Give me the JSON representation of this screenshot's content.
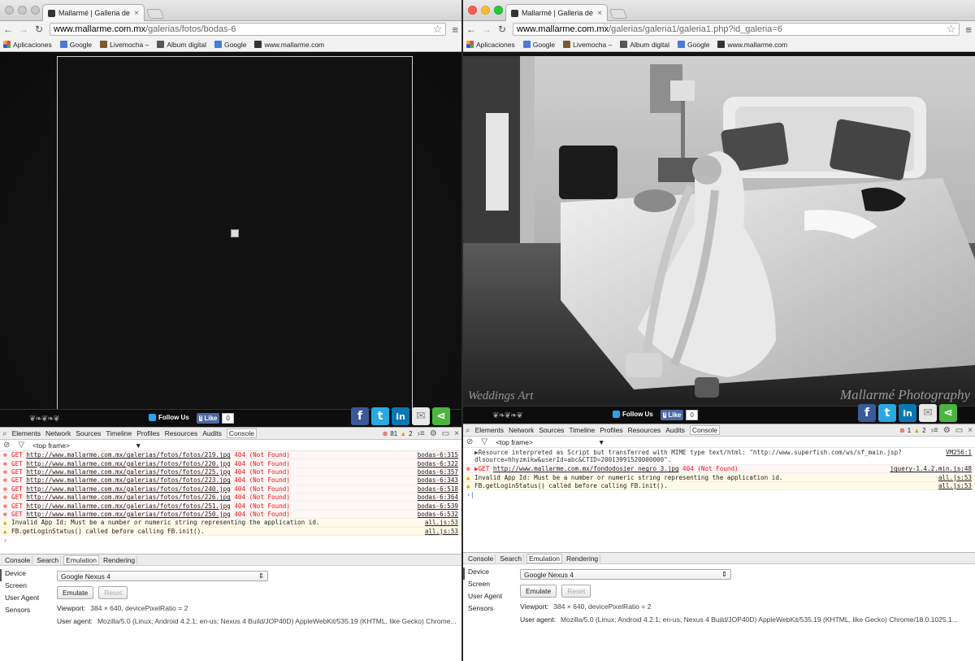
{
  "left": {
    "tab_title": "Mallarmé | Galleria de fotos",
    "url_host": "www.mallarme.com.mx",
    "url_path": "/galerias/fotos/bodas-6",
    "bookmarks": [
      "Aplicaciones",
      "Google",
      "Livemocha –",
      "Album digital",
      "Google",
      "www.mallarme.com"
    ],
    "follow_us": "Follow Us",
    "like": "Like",
    "like_count": "0",
    "devtools_tabs": [
      "Elements",
      "Network",
      "Sources",
      "Timeline",
      "Profiles",
      "Resources",
      "Audits",
      "Console"
    ],
    "error_count": "81",
    "warn_count": "2",
    "frame": "<top frame>",
    "logs": [
      {
        "type": "err",
        "prefix": "GET",
        "url": "http://www.mallarme.com.mx/galerias/fotos/fotos/219.jpg",
        "status": "404 (Not Found)",
        "src": "bodas-6:315"
      },
      {
        "type": "err",
        "prefix": "GET",
        "url": "http://www.mallarme.com.mx/galerias/fotos/fotos/220.jpg",
        "status": "404 (Not Found)",
        "src": "bodas-6:322"
      },
      {
        "type": "err",
        "prefix": "GET",
        "url": "http://www.mallarme.com.mx/galerias/fotos/fotos/225.jpg",
        "status": "404 (Not Found)",
        "src": "bodas-6:357"
      },
      {
        "type": "err",
        "prefix": "GET",
        "url": "http://www.mallarme.com.mx/galerias/fotos/fotos/223.jpg",
        "status": "404 (Not Found)",
        "src": "bodas-6:343"
      },
      {
        "type": "err",
        "prefix": "GET",
        "url": "http://www.mallarme.com.mx/galerias/fotos/fotos/240.jpg",
        "status": "404 (Not Found)",
        "src": "bodas-6:518"
      },
      {
        "type": "err",
        "prefix": "GET",
        "url": "http://www.mallarme.com.mx/galerias/fotos/fotos/226.jpg",
        "status": "404 (Not Found)",
        "src": "bodas-6:364"
      },
      {
        "type": "err",
        "prefix": "GET",
        "url": "http://www.mallarme.com.mx/galerias/fotos/fotos/251.jpg",
        "status": "404 (Not Found)",
        "src": "bodas-6:539"
      },
      {
        "type": "err",
        "prefix": "GET",
        "url": "http://www.mallarme.com.mx/galerias/fotos/fotos/250.jpg",
        "status": "404 (Not Found)",
        "src": "bodas-6:532"
      },
      {
        "type": "warn",
        "prefix": "",
        "url": "",
        "status": "Invalid App Id: Must be a number or numeric string representing the application id.",
        "src": "all.js:53"
      },
      {
        "type": "warn",
        "prefix": "",
        "url": "",
        "status": "FB.getLoginStatus() called before calling FB.init().",
        "src": "all.js:53"
      }
    ],
    "drawer_tabs": [
      "Console",
      "Search",
      "Emulation",
      "Rendering"
    ],
    "emu_side": [
      "Device",
      "Screen",
      "User Agent",
      "Sensors"
    ],
    "device": "Google Nexus 4",
    "emulate": "Emulate",
    "reset": "Reset",
    "viewport_label": "Viewport:",
    "viewport": "384 × 640, devicePixelRatio = 2",
    "ua_label": "User agent:",
    "ua": "Mozilla/5.0 (Linux; Android 4.2.1; en-us; Nexus 4 Build/JOP40D) AppleWebKit/535.19 (KHTML, like Gecko) Chrome..."
  },
  "right": {
    "tab_title": "Mallarmé | Galleria de fotos",
    "url_host": "www.mallarme.com.mx",
    "url_path": "/galerias/galeria1/galeria1.php?id_galeria=6",
    "bookmarks": [
      "Aplicaciones",
      "Google",
      "Livemocha –",
      "Album digital",
      "Google",
      "www.mallarme.com"
    ],
    "follow_us": "Follow Us",
    "like": "Like",
    "like_count": "0",
    "watermark_left": "Weddings Art",
    "watermark_right": "Mallarmé Photography",
    "devtools_tabs": [
      "Elements",
      "Network",
      "Sources",
      "Timeline",
      "Profiles",
      "Resources",
      "Audits",
      "Console"
    ],
    "error_count": "1",
    "warn_count": "2",
    "frame": "<top frame>",
    "info_line": "▶Resource interpreted as Script but transferred with MIME type text/html: \"http://www.superfish.com/ws/sf_main.jsp?dlsource=hhyzmikw&userId=abc&CTID=20013991520000000\".",
    "info_src": "VM256:1",
    "logs": [
      {
        "type": "err",
        "prefix": "▶GET",
        "url": "http://www.mallarme.com.mx/fondodosier_negro_3.jpg",
        "status": "404 (Not Found)",
        "src": "jquery-1.4.2.min.js:48"
      },
      {
        "type": "warn",
        "prefix": "",
        "url": "",
        "status": "Invalid App Id: Must be a number or numeric string representing the application id.",
        "src": "all.js:53"
      },
      {
        "type": "warn",
        "prefix": "",
        "url": "",
        "status": "FB.getLoginStatus() called before calling FB.init().",
        "src": "all.js:53"
      }
    ],
    "drawer_tabs": [
      "Console",
      "Search",
      "Emulation",
      "Rendering"
    ],
    "emu_side": [
      "Device",
      "Screen",
      "User Agent",
      "Sensors"
    ],
    "device": "Google Nexus 4",
    "emulate": "Emulate",
    "reset": "Reset",
    "viewport_label": "Viewport:",
    "viewport": "384 × 640, devicePixelRatio = 2",
    "ua_label": "User agent:",
    "ua": "Mozilla/5.0 (Linux; Android 4.2.1; en-us; Nexus 4 Build/JOP40D) AppleWebKit/535.19 (KHTML, like Gecko) Chrome/18.0.1025.1..."
  }
}
